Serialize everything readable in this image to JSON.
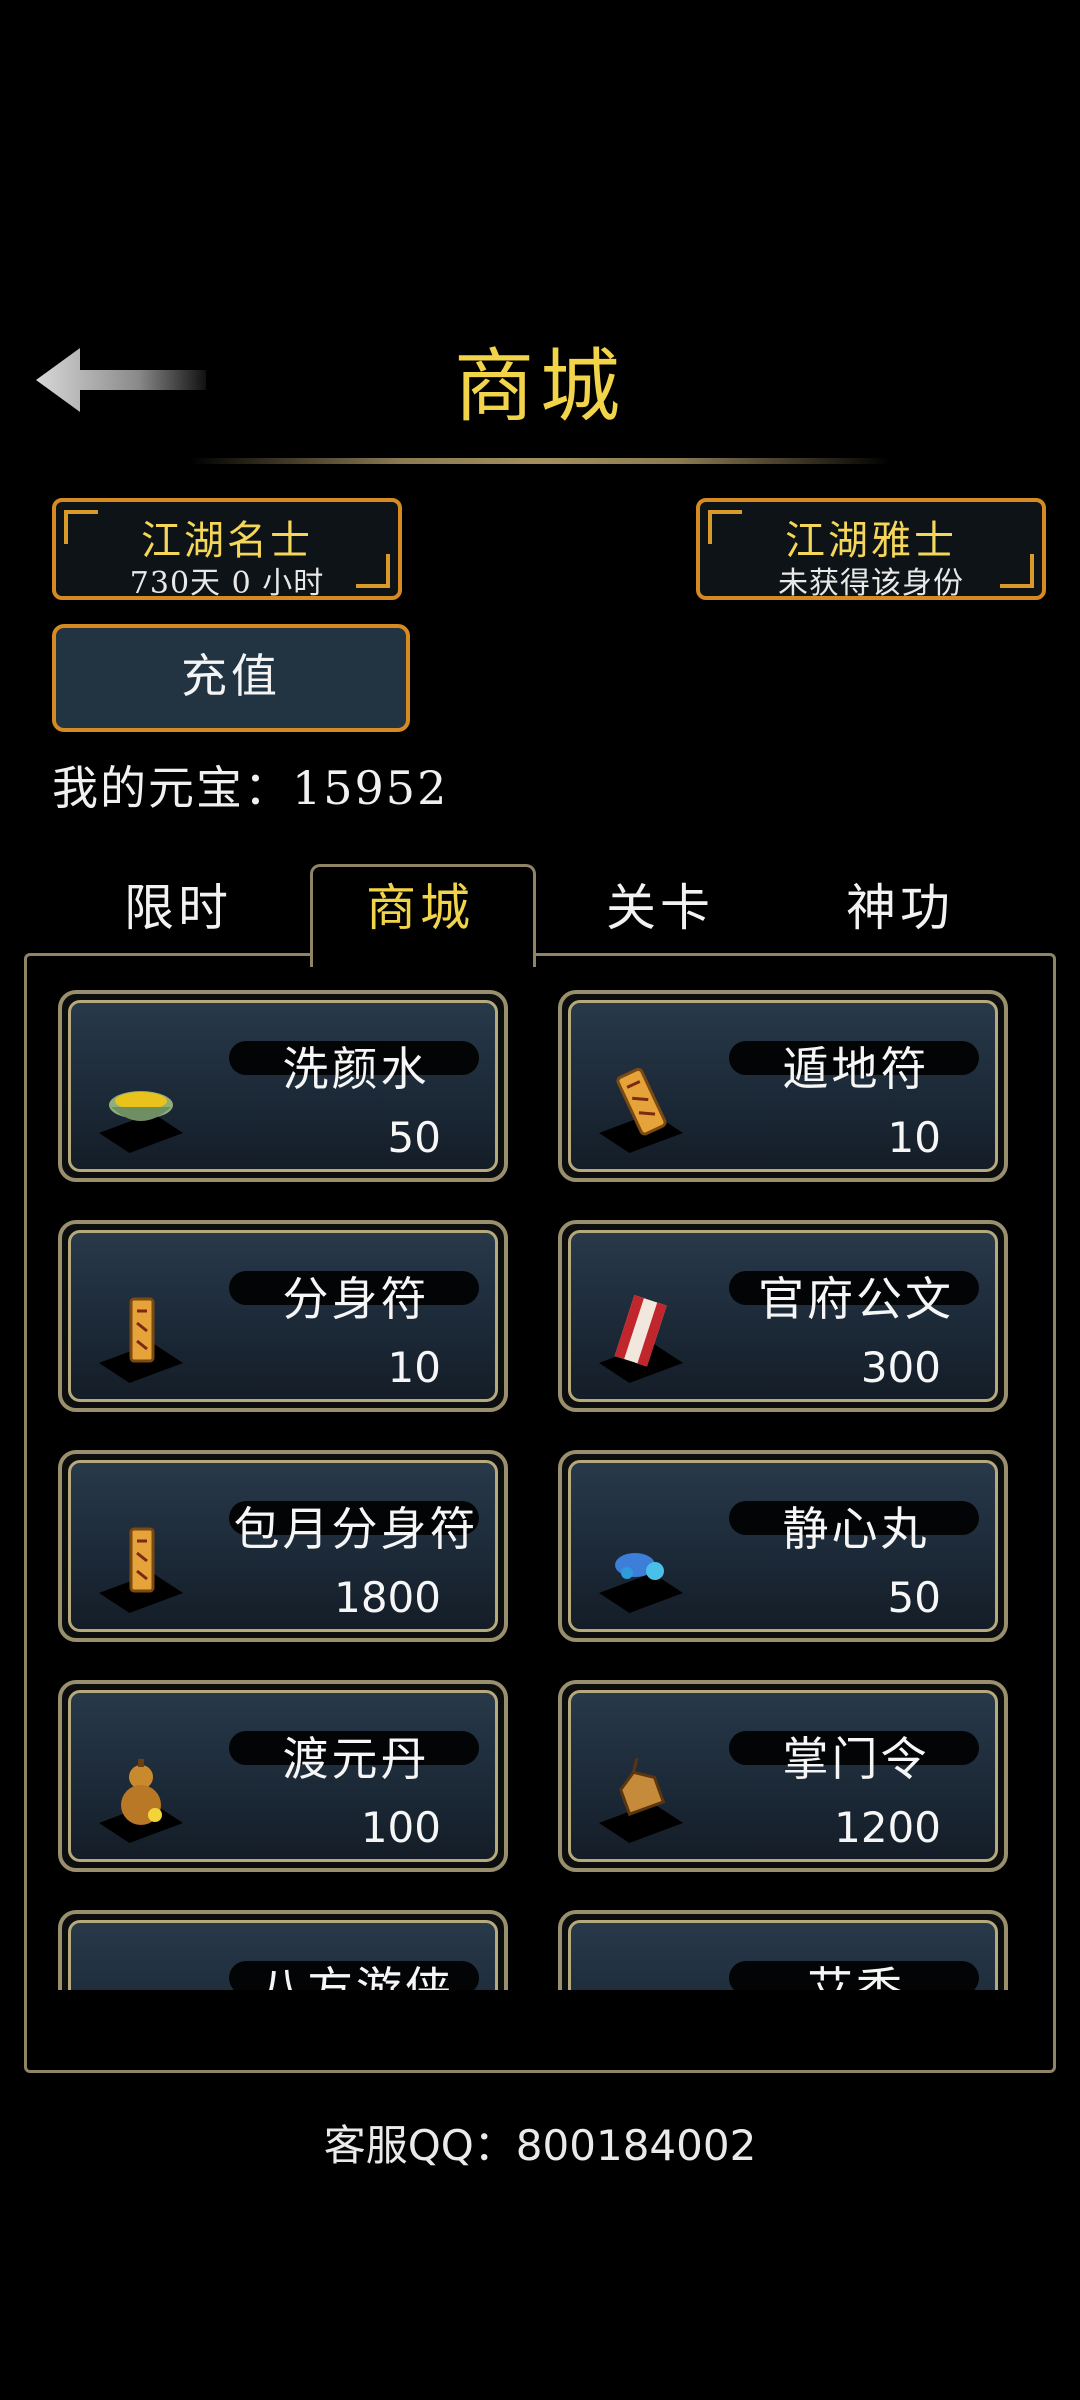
{
  "header": {
    "title": "商城"
  },
  "badges": [
    {
      "name": "江湖名士",
      "sub": "730天 0 小时"
    },
    {
      "name": "江湖雅士",
      "sub": "未获得该身份"
    }
  ],
  "recharge_label": "充值",
  "ingot_text": "我的元宝：15952",
  "tabs": [
    {
      "label": "限时"
    },
    {
      "label": "商城",
      "active": true
    },
    {
      "label": "关卡"
    },
    {
      "label": "神功"
    }
  ],
  "items": [
    {
      "name": "洗颜水",
      "price": "50",
      "icon": "bowl-icon"
    },
    {
      "name": "遁地符",
      "price": "10",
      "icon": "talisman-icon"
    },
    {
      "name": "分身符",
      "price": "10",
      "icon": "talisman-icon"
    },
    {
      "name": "官府公文",
      "price": "300",
      "icon": "document-icon"
    },
    {
      "name": "包月分身符",
      "price": "1800",
      "icon": "talisman-icon"
    },
    {
      "name": "静心丸",
      "price": "50",
      "icon": "pill-icon"
    },
    {
      "name": "渡元丹",
      "price": "100",
      "icon": "gourd-icon"
    },
    {
      "name": "掌门令",
      "price": "1200",
      "icon": "token-icon"
    },
    {
      "name": "八方游侠",
      "price": "",
      "icon": "mask-icon"
    },
    {
      "name": "艾香",
      "price": "",
      "icon": "incense-icon"
    }
  ],
  "footer": {
    "qq": "客服QQ：800184002"
  },
  "colors": {
    "gold": "#f2d44a",
    "frame_orange": "#d58a22",
    "card_border": "#b6a97c"
  }
}
